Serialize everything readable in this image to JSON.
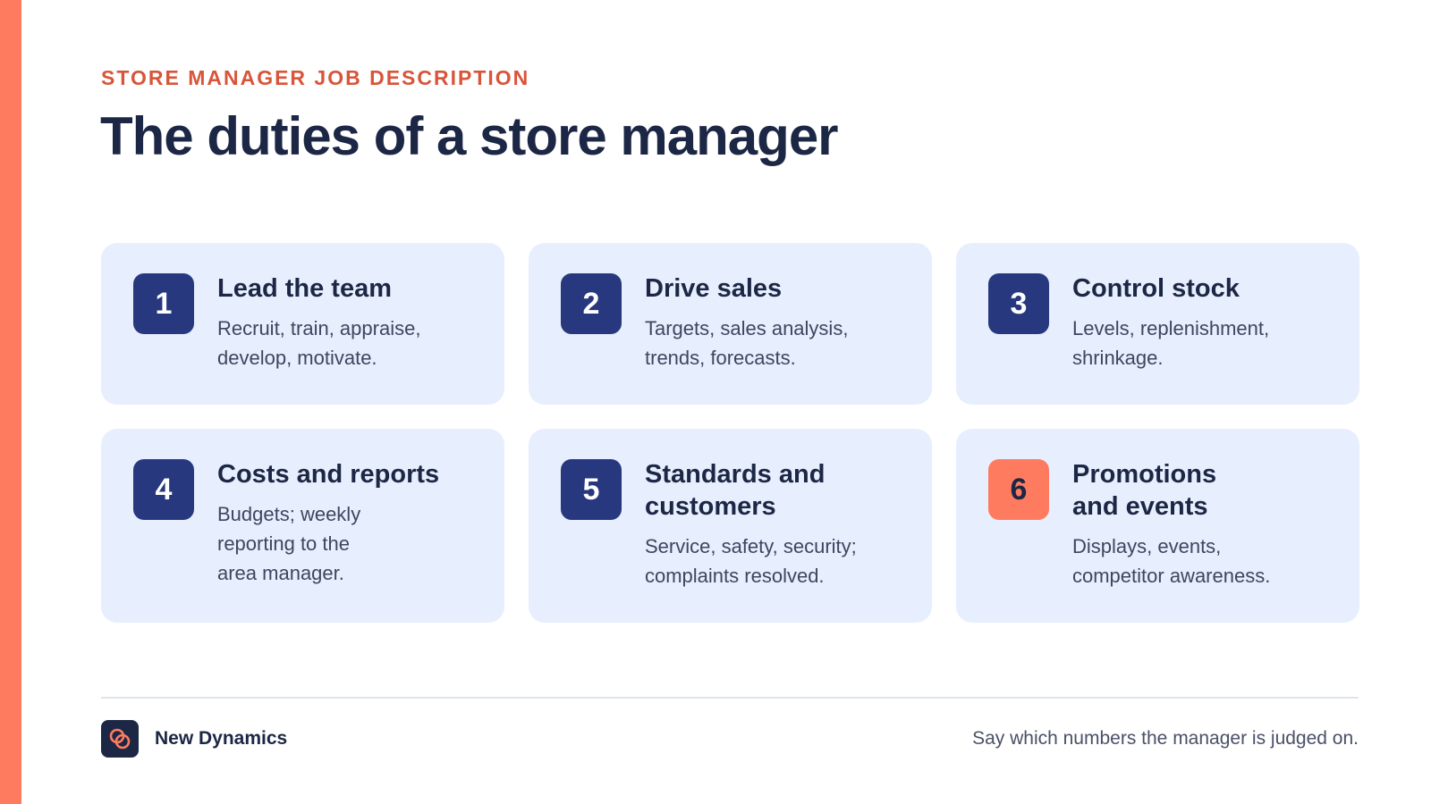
{
  "header": {
    "eyebrow": "STORE MANAGER JOB DESCRIPTION",
    "title": "The duties of a store manager"
  },
  "cards": [
    {
      "number": "1",
      "title": "Lead the team",
      "description": "Recruit, train, appraise,\ndevelop, motivate."
    },
    {
      "number": "2",
      "title": "Drive sales",
      "description": "Targets, sales analysis,\ntrends, forecasts."
    },
    {
      "number": "3",
      "title": "Control stock",
      "description": "Levels, replenishment,\nshrinkage."
    },
    {
      "number": "4",
      "title": "Costs and reports",
      "description": "Budgets; weekly\nreporting to the\narea manager."
    },
    {
      "number": "5",
      "title": "Standards and\ncustomers",
      "description": "Service, safety, security;\ncomplaints resolved."
    },
    {
      "number": "6",
      "title": "Promotions\nand events",
      "description": "Displays, events,\ncompetitor awareness."
    }
  ],
  "footer": {
    "brand": "New Dynamics",
    "note": "Say which numbers the manager is judged on.",
    "logo_icon": "linked-rings-icon"
  },
  "colors": {
    "accent": "#ff7b5f",
    "navy": "#27387f",
    "card_bg": "#e7eefd",
    "eyebrow": "#d8553a"
  }
}
